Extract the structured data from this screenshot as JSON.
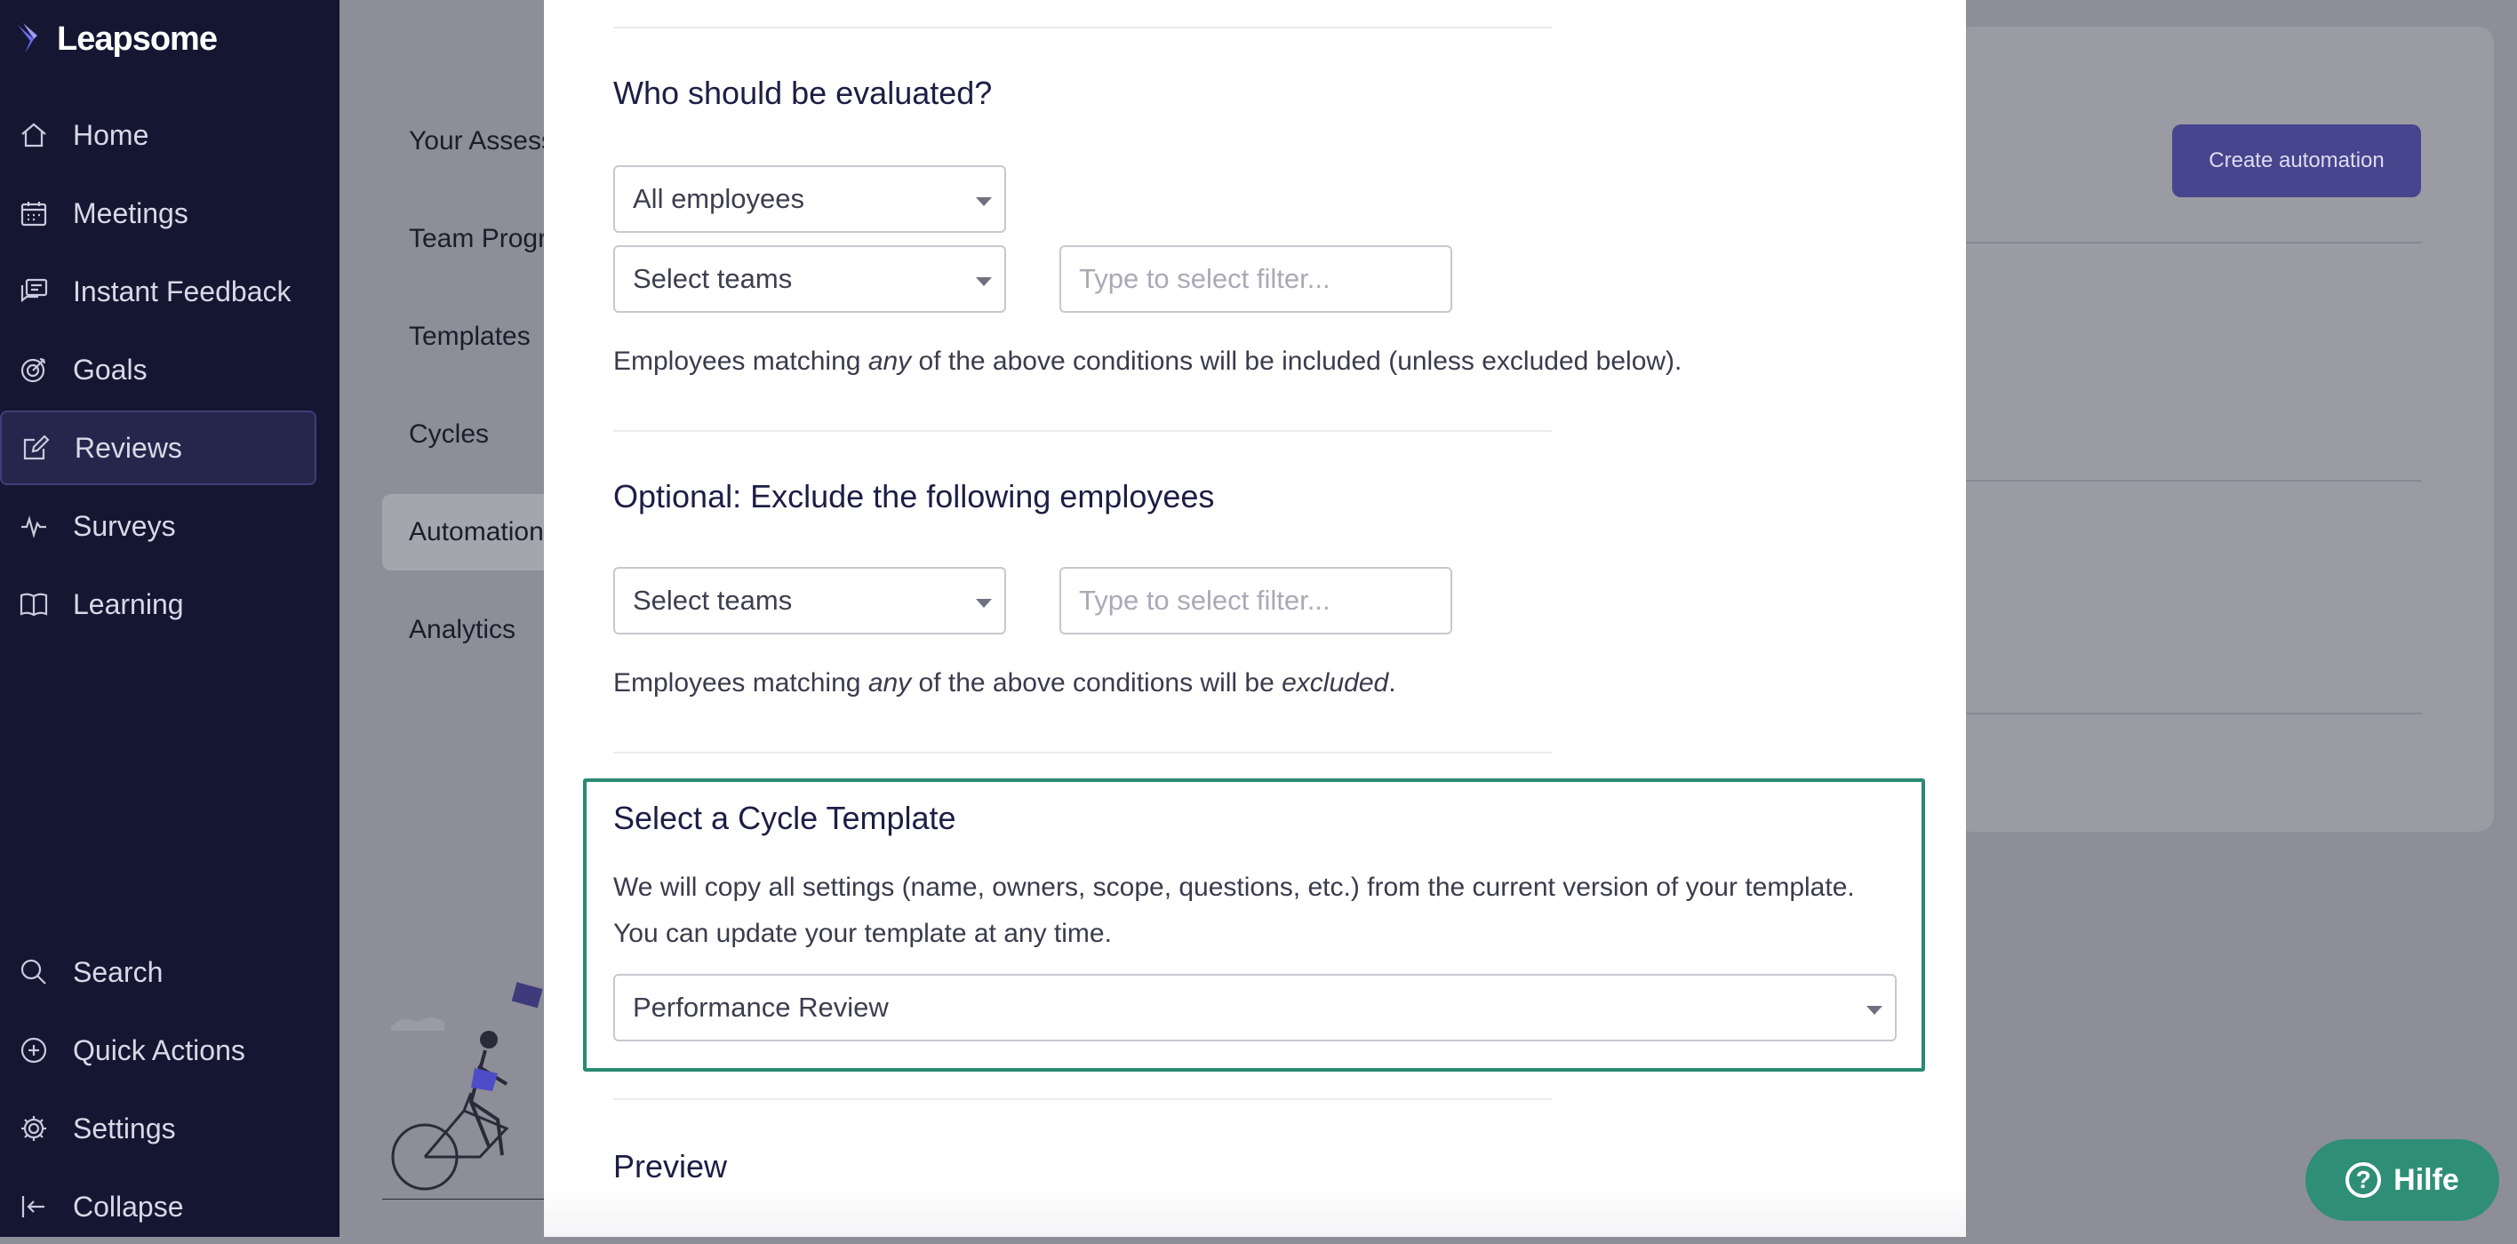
{
  "app": {
    "name": "Leapsome"
  },
  "sidebar": {
    "items": [
      {
        "label": "Home",
        "icon": "home-icon"
      },
      {
        "label": "Meetings",
        "icon": "calendar-icon"
      },
      {
        "label": "Instant Feedback",
        "icon": "chat-icon"
      },
      {
        "label": "Goals",
        "icon": "target-icon"
      },
      {
        "label": "Reviews",
        "icon": "edit-icon",
        "active": true
      },
      {
        "label": "Surveys",
        "icon": "pulse-icon"
      },
      {
        "label": "Learning",
        "icon": "book-icon"
      }
    ],
    "bottom_items": [
      {
        "label": "Search",
        "icon": "search-icon"
      },
      {
        "label": "Quick Actions",
        "icon": "plus-circle-icon"
      },
      {
        "label": "Settings",
        "icon": "gear-icon"
      },
      {
        "label": "Collapse",
        "icon": "collapse-icon"
      }
    ]
  },
  "subnav": {
    "items": [
      {
        "label": "Your Assess"
      },
      {
        "label": "Team Progr"
      },
      {
        "label": "Templates"
      },
      {
        "label": "Cycles"
      },
      {
        "label": "Automation",
        "active": true
      },
      {
        "label": "Analytics"
      }
    ]
  },
  "page": {
    "create_button": "Create automation"
  },
  "modal": {
    "who": {
      "title": "Who should be evaluated?",
      "employees_select": "All employees",
      "teams_select": "Select teams",
      "filter_placeholder": "Type to select filter...",
      "help_pre": "Employees matching ",
      "help_em": "any",
      "help_post": " of the above conditions will be included (unless excluded below)."
    },
    "exclude": {
      "title": "Optional: Exclude the following employees",
      "teams_select": "Select teams",
      "filter_placeholder": "Type to select filter...",
      "help_pre": "Employees matching ",
      "help_em": "any",
      "help_mid": " of the above conditions will be ",
      "help_em2": "excluded",
      "help_post": "."
    },
    "template": {
      "title": "Select a Cycle Template",
      "desc_line1": "We will copy all settings (name, owners, scope, questions, etc.) from the current version of your template.",
      "desc_line2": "You can update your template at any time.",
      "select_value": "Performance Review"
    },
    "preview": {
      "title": "Preview"
    }
  },
  "help_button": {
    "label": "Hilfe"
  },
  "colors": {
    "sidebar_bg": "#151632",
    "accent": "#4f4cc7",
    "highlight": "#2a8a74",
    "help_button": "#2f8f76"
  }
}
